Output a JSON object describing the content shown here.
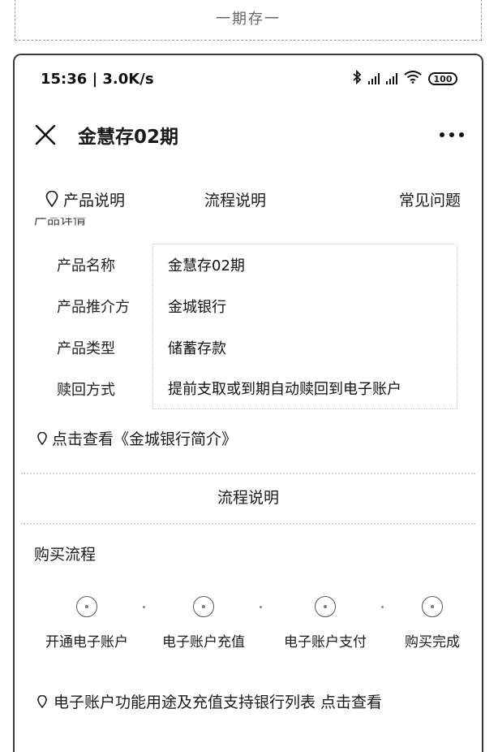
{
  "top_fragment": {
    "text": "一期存一"
  },
  "status_bar": {
    "time_speed": "15:36 | 3.0K/s",
    "battery": "100"
  },
  "navbar": {
    "title": "金慧存02期"
  },
  "tabs": [
    {
      "label": "产品说明"
    },
    {
      "label": "流程说明"
    },
    {
      "label": "常见问题"
    }
  ],
  "section_cut_title": "产品详情",
  "product_info": [
    {
      "key": "产品名称",
      "value": "金慧存02期"
    },
    {
      "key": "产品推介方",
      "value": "金城银行"
    },
    {
      "key": "产品类型",
      "value": "储蓄存款"
    },
    {
      "key": "赎回方式",
      "value": "提前支取或到期自动赎回到电子账户"
    }
  ],
  "bank_link": "点击查看《金城银行简介》",
  "process_header": "流程说明",
  "purchase_flow": {
    "title": "购买流程",
    "steps": [
      {
        "label": "开通电子账户"
      },
      {
        "label": "电子账户充值"
      },
      {
        "label": "电子账户支付"
      },
      {
        "label": "购买完成"
      }
    ]
  },
  "account_link": "电子账户功能用途及充值支持银行列表 点击查看"
}
